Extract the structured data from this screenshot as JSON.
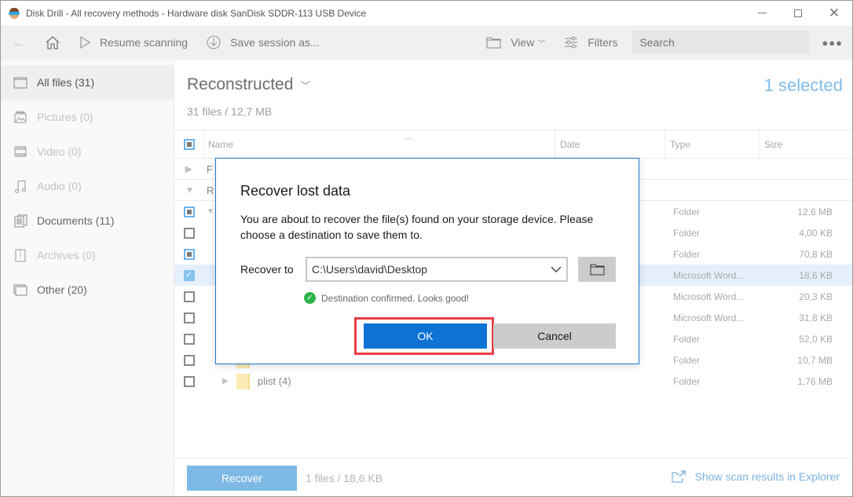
{
  "window": {
    "title": "Disk Drill - All recovery methods - Hardware disk SanDisk SDDR-113 USB Device",
    "app_icon": "disk-drill-logo-icon"
  },
  "toolbar": {
    "back_icon": "arrow-left-icon",
    "home_icon": "home-icon",
    "resume_label": "Resume scanning",
    "save_label": "Save session as...",
    "view_label": "View",
    "filters_label": "Filters",
    "search_placeholder": "Search",
    "more_icon": "more-dots-icon"
  },
  "sidebar": {
    "items": [
      {
        "label": "All files (31)",
        "icon": "files-icon",
        "active": true
      },
      {
        "label": "Pictures (0)",
        "icon": "picture-icon",
        "active": false
      },
      {
        "label": "Video (0)",
        "icon": "film-icon",
        "active": false
      },
      {
        "label": "Audio (0)",
        "icon": "music-icon",
        "active": false
      },
      {
        "label": "Documents (11)",
        "icon": "documents-icon",
        "active": false
      },
      {
        "label": "Archives (0)",
        "icon": "archive-icon",
        "active": false
      },
      {
        "label": "Other (20)",
        "icon": "other-files-icon",
        "active": false
      }
    ]
  },
  "main": {
    "folder_title": "Reconstructed",
    "folder_summary": "31 files / 12,7 MB",
    "selected_count": "1 selected",
    "columns": {
      "name": "Name",
      "date": "Date",
      "type": "Type",
      "size": "Size"
    },
    "groups": [
      {
        "label": "F"
      },
      {
        "label": "R"
      }
    ],
    "rows": [
      {
        "type": "Folder",
        "size": "12,6 MB",
        "check": "partial"
      },
      {
        "type": "Folder",
        "size": "4,00 KB",
        "check": "none"
      },
      {
        "type": "Folder",
        "size": "70,8 KB",
        "check": "partial"
      },
      {
        "type": "Microsoft Word...",
        "size": "18,6 KB",
        "check": "checked"
      },
      {
        "type": "Microsoft Word...",
        "size": "20,3 KB",
        "check": "none"
      },
      {
        "type": "Microsoft Word...",
        "size": "31,8 KB",
        "check": "none"
      },
      {
        "type": "Folder",
        "size": "52,0 KB",
        "check": "none"
      },
      {
        "type": "Folder",
        "size": "10,7 MB",
        "check": "none"
      },
      {
        "name": "plist (4)",
        "type": "Folder",
        "size": "1,76 MB",
        "check": "none"
      }
    ]
  },
  "bottom": {
    "recover_label": "Recover",
    "recover_info": "1 files / 18,6 KB",
    "explorer_link": "Show scan results in Explorer"
  },
  "dialog": {
    "title": "Recover lost data",
    "message": "You are about to recover the file(s) found on your storage device. Please choose a destination to save them to.",
    "recover_to_label": "Recover to",
    "destination_value": "C:\\Users\\david\\Desktop",
    "confirm_text": "Destination confirmed. Looks good!",
    "ok_label": "OK",
    "cancel_label": "Cancel",
    "highlight_color": "#ea3d44",
    "accent_color": "#0d72d3"
  }
}
